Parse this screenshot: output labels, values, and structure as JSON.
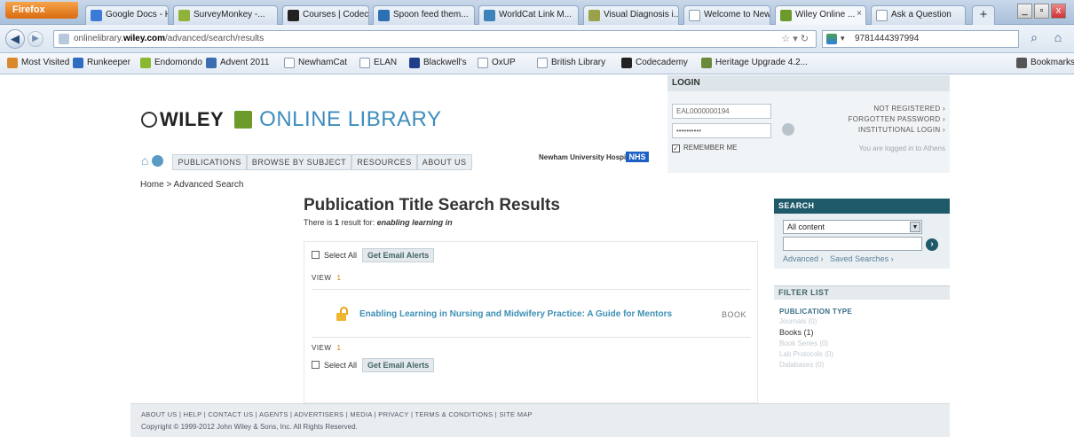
{
  "browser": {
    "firefox_label": "Firefox",
    "tabs": [
      {
        "label": "Google Docs - Ho...",
        "color": "#3b7ad7"
      },
      {
        "label": "SurveyMonkey -...",
        "color": "#8fb33a"
      },
      {
        "label": "Courses | Codec...",
        "color": "#222222"
      },
      {
        "label": "Spoon feed them...",
        "color": "#2c6fb3"
      },
      {
        "label": "WorldCat Link M...",
        "color": "#3d82b8"
      },
      {
        "label": "Visual Diagnosis i...",
        "color": "#9aa14a"
      },
      {
        "label": "Welcome to New...",
        "color": "#ffffff"
      },
      {
        "label": "Wiley Online ...",
        "color": "#6c9a2b"
      },
      {
        "label": "Ask a Question",
        "color": "#ffffff"
      }
    ],
    "new_tab_label": "+",
    "window_controls": [
      "_",
      "▫",
      "x"
    ],
    "url_prefix": "onlinelibrary.",
    "url_domain": "wiley.com",
    "url_path": "/advanced/search/results",
    "search_value": "9781444397994",
    "bookmarks": [
      {
        "label": "Most Visited",
        "color": "#d9892c"
      },
      {
        "label": "Runkeeper",
        "color": "#2f6bc0"
      },
      {
        "label": "Endomondo",
        "color": "#8ab833"
      },
      {
        "label": "Advent 2011",
        "color": "#3d6cb0"
      },
      {
        "label": "NewhamCat",
        "color": "page"
      },
      {
        "label": "ELAN",
        "color": "page"
      },
      {
        "label": "Blackwell's",
        "color": "#1f3f8a"
      },
      {
        "label": "OxUP",
        "color": "page"
      },
      {
        "label": "British Library",
        "color": "page"
      },
      {
        "label": "Codecademy",
        "color": "#222222"
      },
      {
        "label": "Heritage Upgrade 4.2...",
        "color": "#6a8a3a"
      }
    ],
    "bookmarks_menu": "Bookmarks"
  },
  "site": {
    "logo_wiley": "WILEY",
    "logo_online_library": "ONLINE LIBRARY",
    "nav": [
      "PUBLICATIONS",
      "BROWSE BY SUBJECT",
      "RESOURCES",
      "ABOUT US"
    ],
    "institution": "Newham University Hospital",
    "institution_badge": "NHS"
  },
  "login": {
    "header": "LOGIN",
    "username_value": "EAL0000000194",
    "password_value": "••••••••••",
    "remember_label": "REMEMBER ME",
    "not_registered": "NOT REGISTERED ›",
    "forgotten_password": "FORGOTTEN PASSWORD ›",
    "institutional_login": "INSTITUTIONAL LOGIN ›",
    "status": "You are logged in to Athens"
  },
  "breadcrumb": {
    "home": "Home",
    "sep": ">",
    "current": "Advanced Search"
  },
  "results": {
    "title": "Publication Title Search Results",
    "summary_prefix": "There is",
    "count": "1",
    "summary_mid": "result for:",
    "query": "enabling learning in",
    "select_all": "Select All",
    "email_alerts": "Get Email Alerts",
    "view_label": "VIEW",
    "view_count": "1",
    "items": [
      {
        "title": "Enabling Learning in Nursing and Midwifery Practice: A Guide for Mentors",
        "type": "BOOK"
      }
    ]
  },
  "search_panel": {
    "header": "SEARCH",
    "scope": "All content",
    "query": "",
    "advanced": "Advanced ›",
    "saved": "Saved Searches ›"
  },
  "filter": {
    "header": "FILTER LIST",
    "group": "PUBLICATION TYPE",
    "options": [
      {
        "label": "Journals (0)",
        "active": false
      },
      {
        "label": "Books (1)",
        "active": true
      },
      {
        "label": "Book Series (0)",
        "active": false
      },
      {
        "label": "Lab Protocols (0)",
        "active": false
      },
      {
        "label": "Databases (0)",
        "active": false
      }
    ]
  },
  "footer": {
    "links": [
      "ABOUT US",
      "HELP",
      "CONTACT US",
      "AGENTS",
      "ADVERTISERS",
      "MEDIA",
      "PRIVACY",
      "TERMS & CONDITIONS",
      "SITE MAP"
    ],
    "copyright": "Copyright © 1999-2012 John Wiley & Sons, Inc. All Rights Reserved."
  }
}
